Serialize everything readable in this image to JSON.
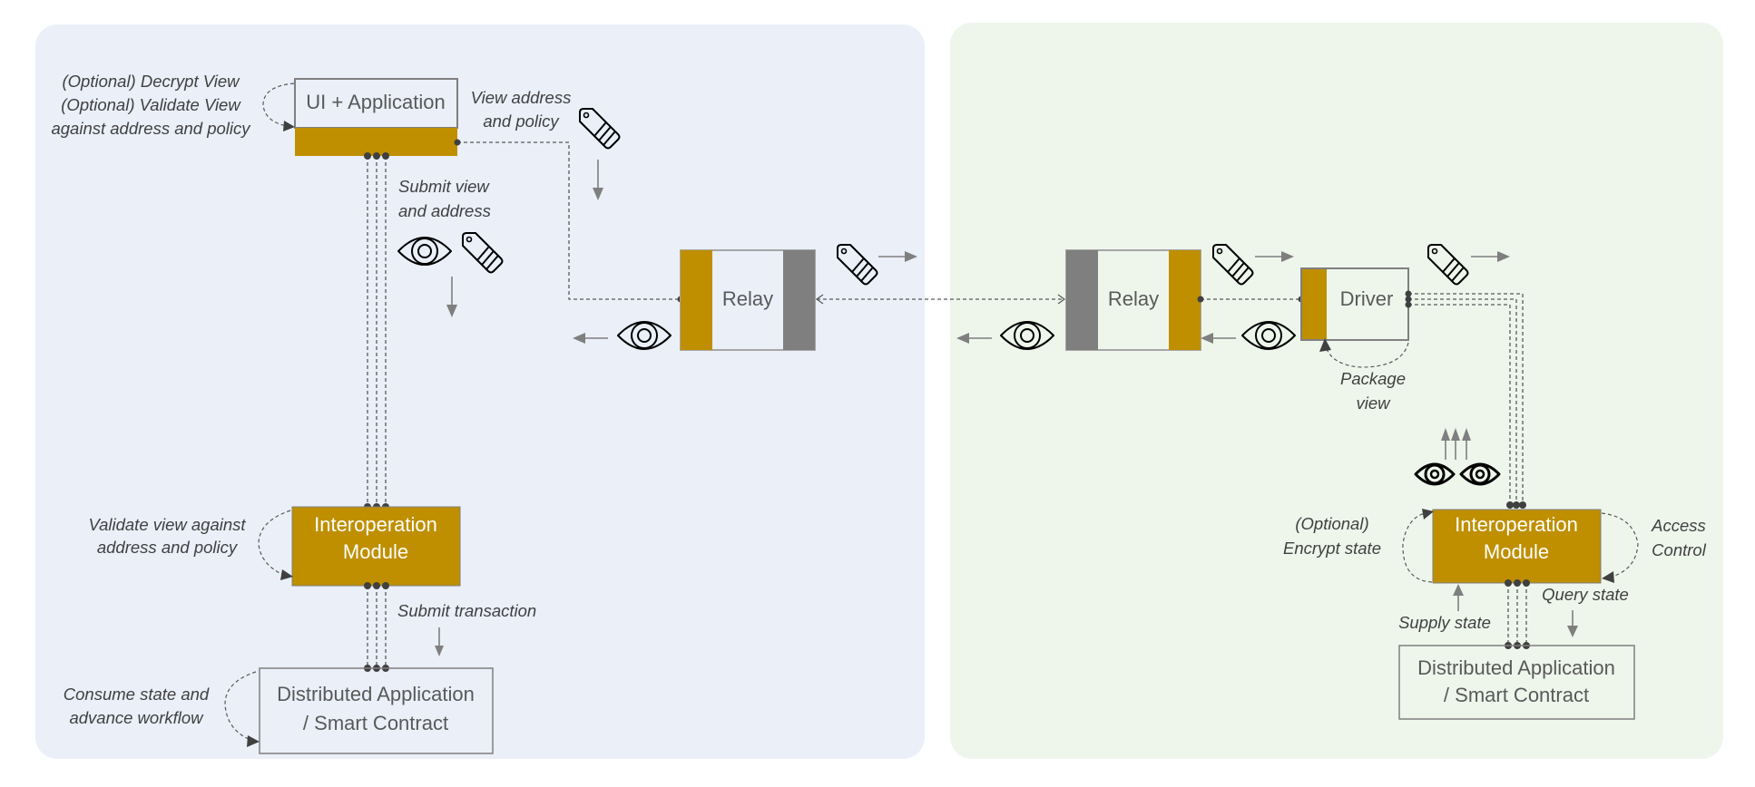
{
  "panels": {
    "left": {
      "color": "#eaeff8"
    },
    "right": {
      "color": "#eef6ec"
    }
  },
  "colors": {
    "accent_gold": "#bf8f00",
    "relay_grey": "#7f7f7f",
    "text": "#404040",
    "box_text": "#595959"
  },
  "left": {
    "ui_app": {
      "label": "UI + Application"
    },
    "ui_note": {
      "line1": "(Optional) Decrypt View",
      "line2": "(Optional) Validate View",
      "line3": "against address and policy"
    },
    "view_address_note": {
      "line1": "View address",
      "line2": "and policy"
    },
    "submit_view_note": {
      "line1": "Submit view",
      "line2": "and address"
    },
    "relay": {
      "label": "Relay"
    },
    "interop": {
      "line1": "Interoperation",
      "line2": "Module"
    },
    "interop_note": {
      "line1": "Validate view against",
      "line2": "address and policy"
    },
    "submit_tx_note": {
      "label": "Submit transaction"
    },
    "dapp": {
      "line1": "Distributed Application",
      "line2": "/ Smart Contract"
    },
    "dapp_note": {
      "line1": "Consume state and",
      "line2": "advance workflow"
    }
  },
  "right": {
    "relay": {
      "label": "Relay"
    },
    "driver": {
      "label": "Driver"
    },
    "package_note": {
      "line1": "Package",
      "line2": "view"
    },
    "interop": {
      "line1": "Interoperation",
      "line2": "Module"
    },
    "encrypt_note": {
      "line1": "(Optional)",
      "line2": "Encrypt state"
    },
    "access_note": {
      "line1": "Access",
      "line2": "Control"
    },
    "supply_note": {
      "label": "Supply state"
    },
    "query_note": {
      "label": "Query state"
    },
    "dapp": {
      "line1": "Distributed Application",
      "line2": "/ Smart Contract"
    }
  },
  "icons": {
    "tag": "tag-icon",
    "eye": "eye-icon"
  }
}
